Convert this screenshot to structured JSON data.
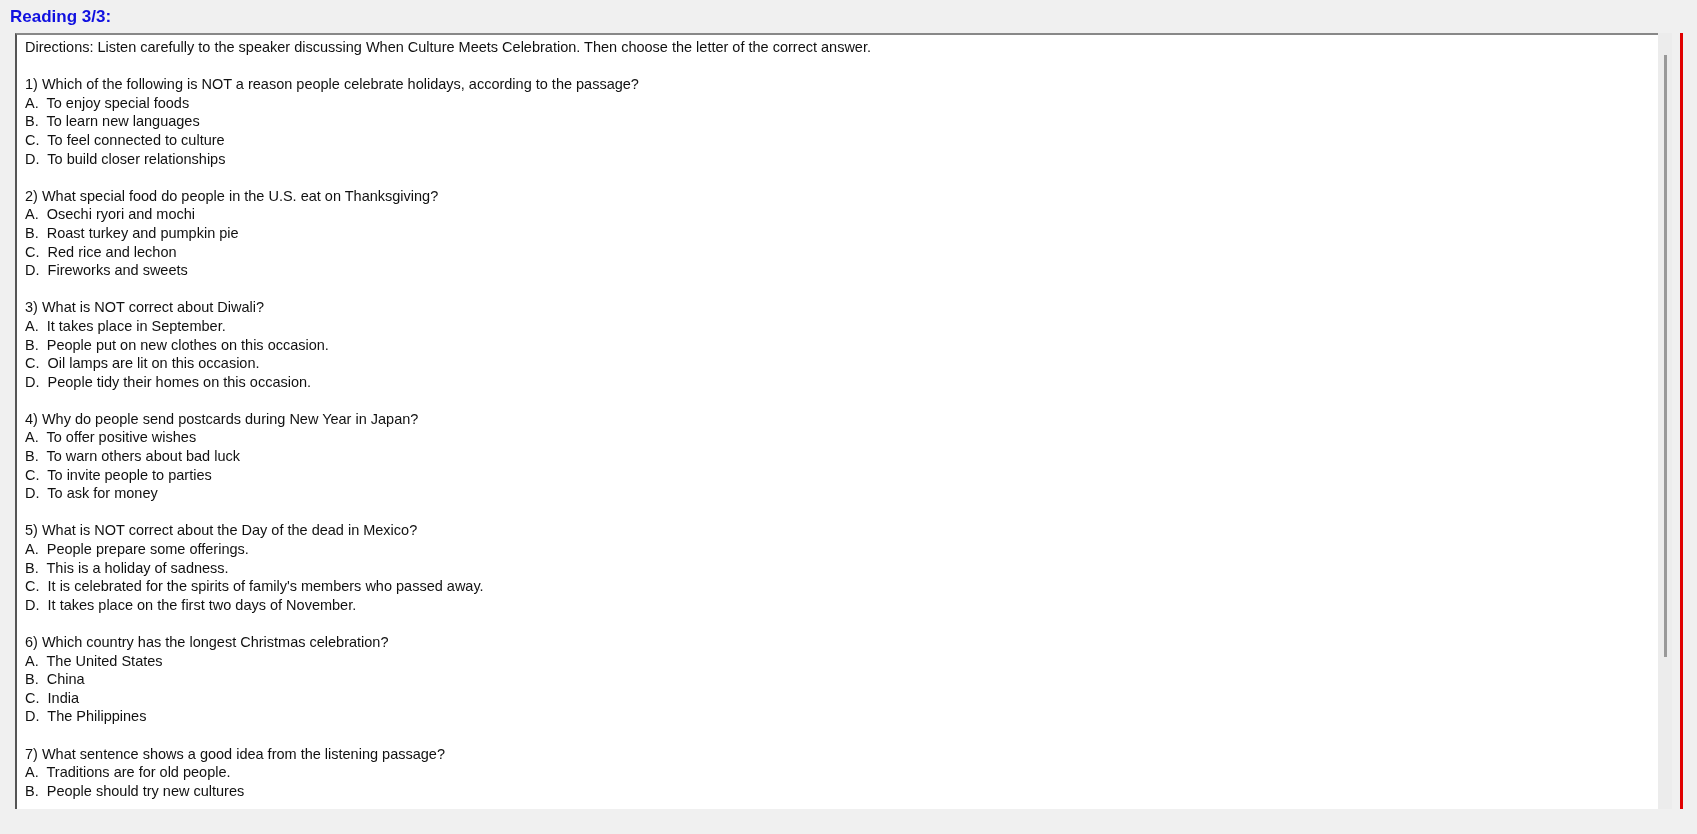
{
  "title": "Reading 3/3:",
  "directions": "Directions: Listen carefully to the speaker discussing When Culture Meets Celebration. Then choose the letter of the correct answer.",
  "questions": [
    {
      "question": "1) Which of the following is NOT a reason people celebrate holidays, according to the passage?",
      "options": [
        "A.  To enjoy special foods",
        "B.  To learn new languages",
        "C.  To feel connected to culture",
        "D.  To build closer relationships"
      ]
    },
    {
      "question": "2) What special food do people in the U.S. eat on Thanksgiving?",
      "options": [
        "A.  Osechi ryori and mochi",
        "B.  Roast turkey and pumpkin pie",
        "C.  Red rice and lechon",
        "D.  Fireworks and sweets"
      ]
    },
    {
      "question": "3) What is NOT correct about Diwali?",
      "options": [
        "A.  It takes place in September.",
        "B.  People put on new clothes on this occasion.",
        "C.  Oil lamps are lit on this occasion.",
        "D.  People tidy their homes on this occasion."
      ]
    },
    {
      "question": "4) Why do people send postcards during New Year in Japan?",
      "options": [
        "A.  To offer positive wishes",
        "B.  To warn others about bad luck",
        "C.  To invite people to parties",
        "D.  To ask for money"
      ]
    },
    {
      "question": "5) What is NOT correct about the Day of the dead in Mexico?",
      "options": [
        "A.  People prepare some offerings.",
        "B.  This is a holiday of sadness.",
        "C.  It is celebrated for the spirits of family's members who passed away.",
        "D.  It takes place on the first two days of November."
      ]
    },
    {
      "question": "6) Which country has the longest Christmas celebration?",
      "options": [
        "A.  The United States",
        "B.  China",
        "C.  India",
        "D.  The Philippines"
      ]
    },
    {
      "question": "7) What sentence shows a good idea from the listening passage?",
      "options": [
        "A.  Traditions are for old people.",
        "B.  People should try new cultures"
      ]
    }
  ]
}
